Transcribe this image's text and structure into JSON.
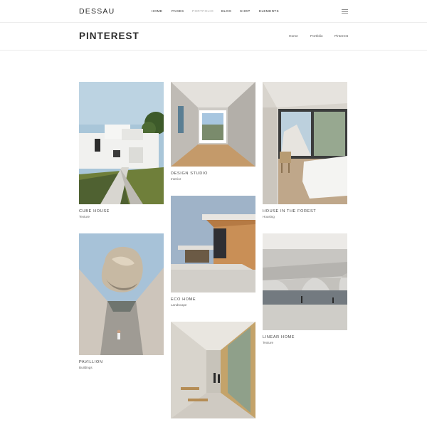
{
  "site": {
    "logo": "DESSAU"
  },
  "nav": {
    "items": [
      {
        "label": "HOME"
      },
      {
        "label": "PAGES"
      },
      {
        "label": "PORTFOLIO"
      },
      {
        "label": "BLOG"
      },
      {
        "label": "SHOP"
      },
      {
        "label": "ELEMENTS"
      }
    ],
    "active": "PORTFOLIO",
    "menu_icon": "hamburger-icon"
  },
  "page": {
    "title": "PINTEREST",
    "breadcrumb": [
      "Home",
      "Portfolio",
      "Pinterest"
    ]
  },
  "portfolio": {
    "items": [
      {
        "title": "CUBE HOUSE",
        "category": "Texture"
      },
      {
        "title": "PAVILLION",
        "category": "Buildings"
      },
      {
        "title": "DESIGN STUDIO",
        "category": "Interior"
      },
      {
        "title": "ECO HOME",
        "category": "Landscape"
      },
      {
        "title": "",
        "category": ""
      },
      {
        "title": "HOUSE IN THE FOREST",
        "category": "Housing"
      },
      {
        "title": "LINEAR HOME",
        "category": "Texture"
      }
    ]
  },
  "colors": {
    "text": "#2b2b2b",
    "nav_active": "#a8a8a8",
    "divider": "#ececec"
  }
}
